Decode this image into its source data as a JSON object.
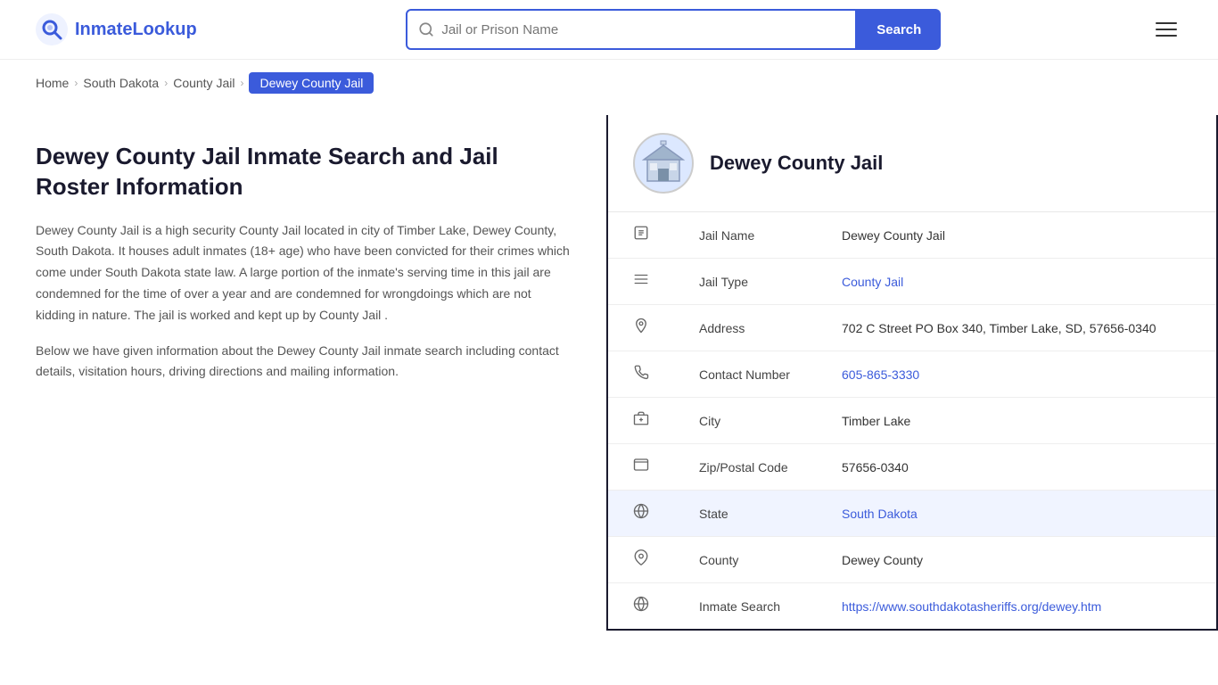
{
  "header": {
    "logo_text": "InmateLookup",
    "search_placeholder": "Jail or Prison Name",
    "search_button_label": "Search"
  },
  "breadcrumb": {
    "items": [
      {
        "label": "Home",
        "href": "#",
        "active": false
      },
      {
        "label": "South Dakota",
        "href": "#",
        "active": false
      },
      {
        "label": "County Jail",
        "href": "#",
        "active": false
      },
      {
        "label": "Dewey County Jail",
        "href": "#",
        "active": true
      }
    ]
  },
  "page": {
    "title": "Dewey County Jail Inmate Search and Jail Roster Information",
    "description1": "Dewey County Jail is a high security County Jail located in city of Timber Lake, Dewey County, South Dakota. It houses adult inmates (18+ age) who have been convicted for their crimes which come under South Dakota state law. A large portion of the inmate's serving time in this jail are condemned for the time of over a year and are condemned for wrongdoings which are not kidding in nature. The jail is worked and kept up by County Jail .",
    "description2": "Below we have given information about the Dewey County Jail inmate search including contact details, visitation hours, driving directions and mailing information."
  },
  "facility": {
    "name": "Dewey County Jail",
    "details": [
      {
        "key": "jail_name",
        "label": "Jail Name",
        "value": "Dewey County Jail",
        "link": null,
        "icon": "building",
        "highlighted": false
      },
      {
        "key": "jail_type",
        "label": "Jail Type",
        "value": "County Jail",
        "link": "#",
        "icon": "list",
        "highlighted": false
      },
      {
        "key": "address",
        "label": "Address",
        "value": "702 C Street PO Box 340, Timber Lake, SD, 57656-0340",
        "link": null,
        "icon": "pin",
        "highlighted": false
      },
      {
        "key": "contact",
        "label": "Contact Number",
        "value": "605-865-3330",
        "link": "tel:6058653330",
        "icon": "phone",
        "highlighted": false
      },
      {
        "key": "city",
        "label": "City",
        "value": "Timber Lake",
        "link": null,
        "icon": "map",
        "highlighted": false
      },
      {
        "key": "zip",
        "label": "Zip/Postal Code",
        "value": "57656-0340",
        "link": null,
        "icon": "mail",
        "highlighted": false
      },
      {
        "key": "state",
        "label": "State",
        "value": "South Dakota",
        "link": "#",
        "icon": "globe",
        "highlighted": true
      },
      {
        "key": "county",
        "label": "County",
        "value": "Dewey County",
        "link": null,
        "icon": "location",
        "highlighted": false
      },
      {
        "key": "inmate_search",
        "label": "Inmate Search",
        "value": "https://www.southdakotasheriffs.org/dewey.htm",
        "link": "https://www.southdakotasheriffs.org/dewey.htm",
        "icon": "globe2",
        "highlighted": false
      }
    ]
  }
}
